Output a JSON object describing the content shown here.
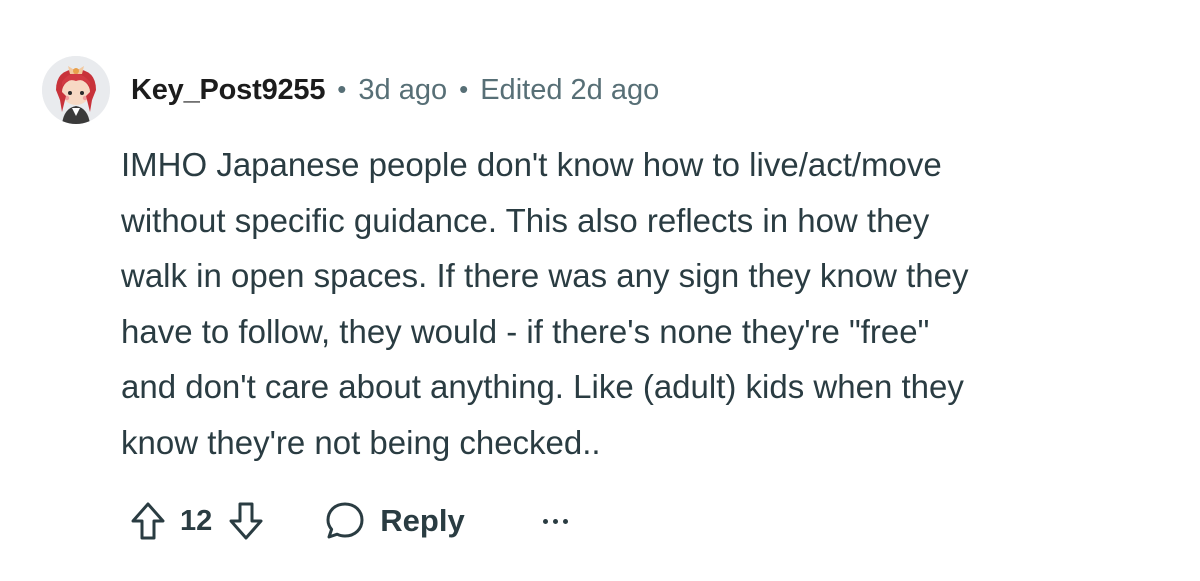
{
  "comment": {
    "author": "Key_Post9255",
    "separator": "•",
    "age": "3d ago",
    "edited": "Edited 2d ago",
    "body_lines": [
      "IMHO Japanese people don't know how to live/act/move",
      "without specific guidance. This also reflects in how they",
      "walk in open spaces. If there was any sign they know they",
      "have to follow, they would - if there's none they're \"free\"",
      "and don't care about anything. Like (adult) kids when they",
      "know they're not being checked.."
    ],
    "score": "12",
    "reply_label": "Reply",
    "icons": {
      "avatar": "avatar",
      "upvote": "upvote-arrow-icon",
      "downvote": "downvote-arrow-icon",
      "reply": "speech-bubble-icon",
      "more": "ellipsis-icon"
    }
  },
  "colors": {
    "text": "#1c1c1c",
    "body": "#2a3c42",
    "meta": "#576f76",
    "background": "#ffffff"
  }
}
